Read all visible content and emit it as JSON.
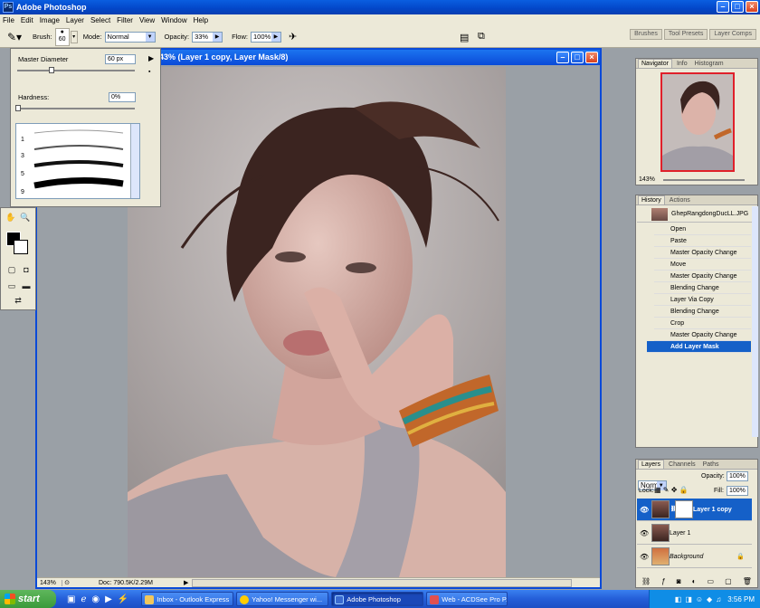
{
  "app": {
    "title": "Adobe Photoshop"
  },
  "menu": [
    "File",
    "Edit",
    "Image",
    "Layer",
    "Select",
    "Filter",
    "View",
    "Window",
    "Help"
  ],
  "options": {
    "brush_label": "Brush:",
    "brush_size": "60",
    "mode_label": "Mode:",
    "mode_value": "Normal",
    "opacity_label": "Opacity:",
    "opacity_value": "33%",
    "flow_label": "Flow:",
    "flow_value": "100%",
    "wells": [
      "Brushes",
      "Tool Presets",
      "Layer Comps"
    ]
  },
  "brush_picker": {
    "master_diameter_label": "Master Diameter",
    "master_diameter_value": "60 px",
    "hardness_label": "Hardness:",
    "hardness_value": "0%",
    "brush_numbers": [
      "1",
      "3",
      "5",
      "9"
    ]
  },
  "document": {
    "title": "43% (Layer 1 copy, Layer Mask/8)",
    "zoom": "143%",
    "doc_size": "Doc: 790.5K/2.29M"
  },
  "navigator": {
    "tabs": [
      "Navigator",
      "Info",
      "Histogram"
    ],
    "zoom": "143%"
  },
  "history": {
    "tabs": [
      "History",
      "Actions"
    ],
    "snapshot": "GhepRangdongDucLL.JPG",
    "items": [
      "Open",
      "Paste",
      "Master Opacity Change",
      "Move",
      "Master Opacity Change",
      "Blending Change",
      "Layer Via Copy",
      "Blending Change",
      "Crop",
      "Master Opacity Change",
      "Add Layer Mask"
    ],
    "active_index": 10
  },
  "layers": {
    "tabs": [
      "Layers",
      "Channels",
      "Paths"
    ],
    "blend_mode": "Normal",
    "opacity_label": "Opacity:",
    "opacity_value": "100%",
    "lock_label": "Lock:",
    "fill_label": "Fill:",
    "fill_value": "100%",
    "items": [
      "Layer 1 copy",
      "Layer 1",
      "Background"
    ],
    "active_index": 0
  },
  "taskbar": {
    "start_label": "start",
    "tasks": [
      "Inbox - Outlook Express",
      "Yahoo! Messenger wi...",
      "Adobe Photoshop",
      "Web - ACDSee Pro P..."
    ],
    "active_index": 2,
    "clock": "3:56 PM"
  },
  "colors": {
    "xp_blue": "#0a4ad8",
    "selection_blue": "#1560c8",
    "panel_bg": "#ece9d8",
    "workspace_gray": "#9aa0a6",
    "start_green": "#3a9a3a"
  }
}
